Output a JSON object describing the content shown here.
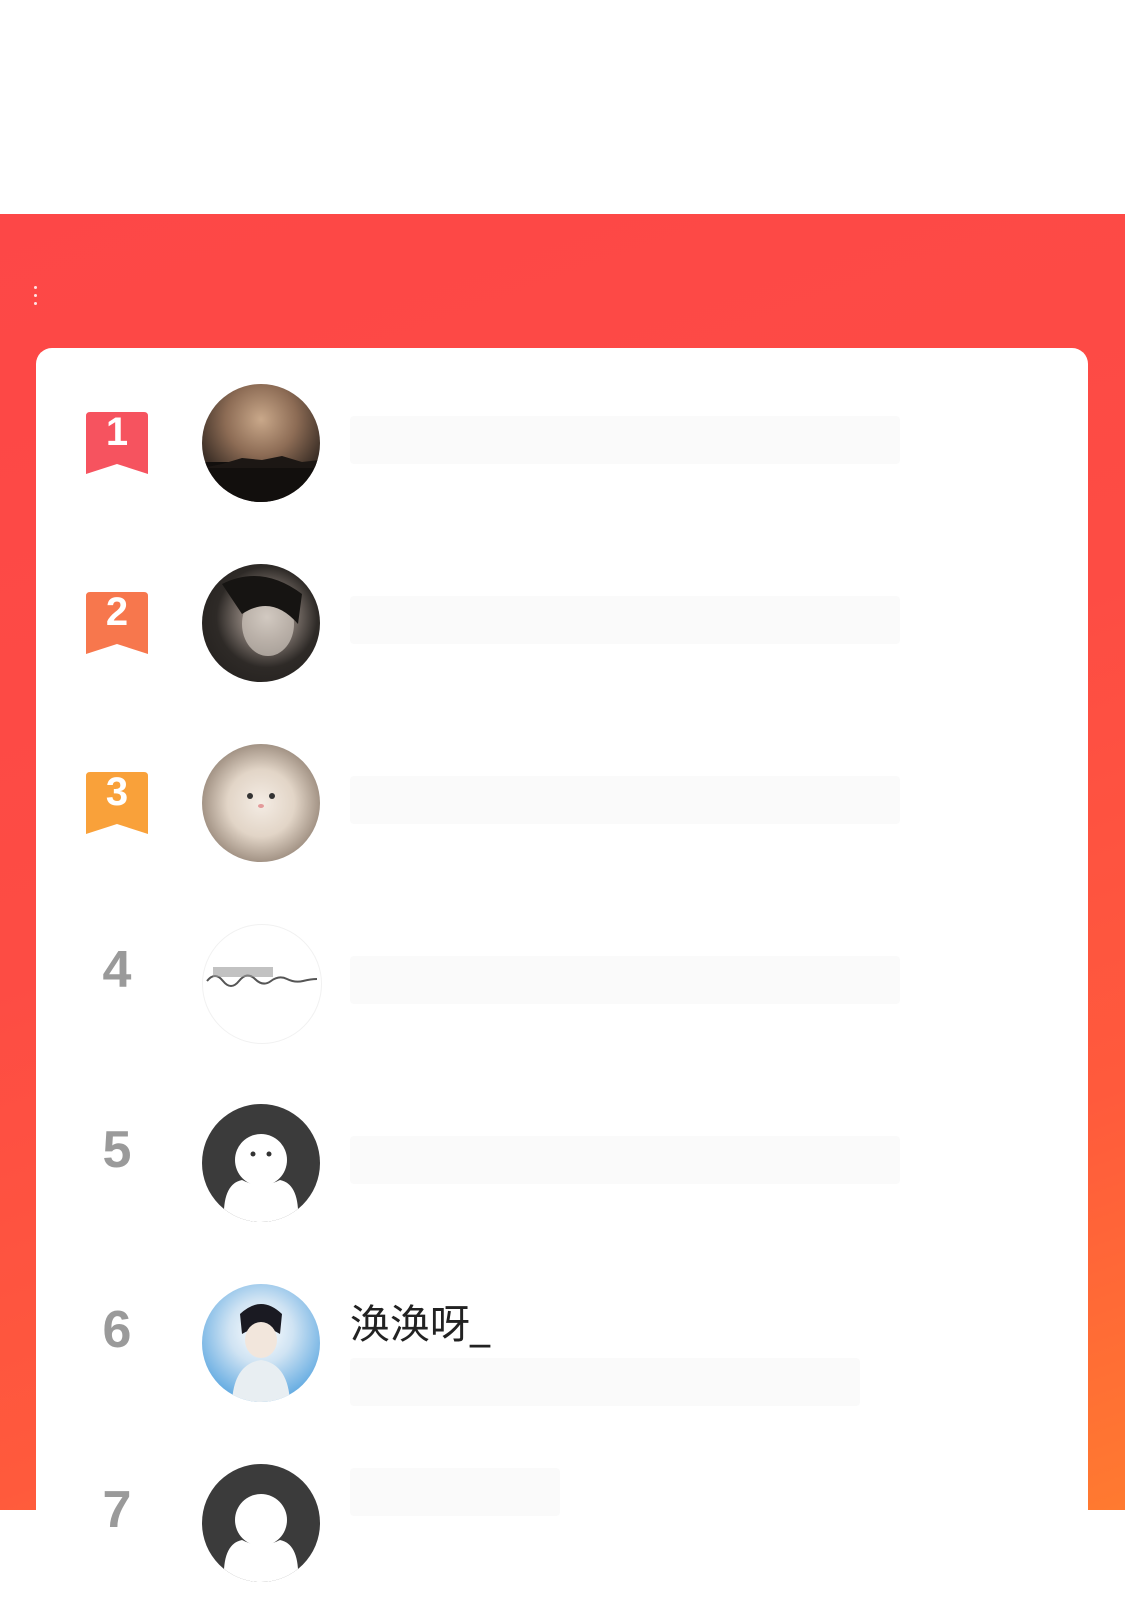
{
  "theme": {
    "panel_color": "#fd4747",
    "gradient_end": "#ff7a30",
    "rank1": "#f6535f",
    "rank2": "#f7774d",
    "rank3": "#f9a13a"
  },
  "ranking": [
    {
      "rank": "1",
      "name": "",
      "avatar_icon": "sunset-avatar-icon"
    },
    {
      "rank": "2",
      "name": "",
      "avatar_icon": "portrait-avatar-icon"
    },
    {
      "rank": "3",
      "name": "",
      "avatar_icon": "cat-avatar-icon"
    },
    {
      "rank": "4",
      "name": "",
      "avatar_icon": "handwriting-avatar-icon"
    },
    {
      "rank": "5",
      "name": "",
      "avatar_icon": "default-avatar-icon"
    },
    {
      "rank": "6",
      "name": "涣涣呀_",
      "avatar_icon": "anime-avatar-icon"
    },
    {
      "rank": "7",
      "name": "",
      "avatar_icon": "default-avatar-icon"
    }
  ]
}
